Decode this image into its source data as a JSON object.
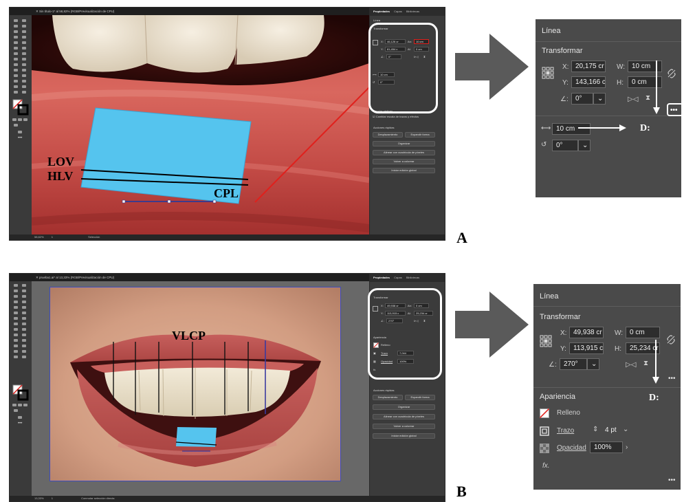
{
  "figure_a": {
    "letter": "A",
    "window": {
      "title": "Sin título-1* al 58,82% (RGB/Previsualización de CPU)",
      "zoom": "58,82%",
      "page": "1",
      "status_tool": "Selección"
    },
    "overlay_labels": {
      "lov": "LOV",
      "hlv": "HLV",
      "cpl": "CPL"
    },
    "panel": {
      "tabs": [
        "Propiedades",
        "Capas",
        "Bibliotecas"
      ],
      "section_header": "Línea",
      "transform": "Transformar",
      "x_value": "46,126 cr",
      "y_value": "81,454 c",
      "w_label": "An:",
      "w_value": "10 cm",
      "h_label": "Al:",
      "h_value": "0 cm",
      "angle_value": "0°",
      "length_value": "10 cm",
      "rotation_value": "0°",
      "scale_corners": "Escalar vértices",
      "scale_strokes": "Cambiar escala de trazos y efectos",
      "quick_actions": "Acciones rápidas",
      "btn_offset": "Desplazamiento",
      "btn_expand": "Expandir forma",
      "btn_arrange": "Organizar",
      "btn_align_grid": "Alinear con cuadrícula de píxeles",
      "btn_recolor": "Volver a colorear",
      "btn_global_edit": "Iniciar edición global"
    },
    "zoom_panel": {
      "title": "Línea",
      "transform": "Transformar",
      "x_label": "X:",
      "x_value": "20,175 cr",
      "y_label": "Y:",
      "y_value": "143,166 c",
      "w_label": "W:",
      "w_value": "10 cm",
      "h_label": "H:",
      "h_value": "0 cm",
      "angle_value": "0°",
      "length_value": "10 cm",
      "rotation_value": "0°",
      "d_label": "D:"
    }
  },
  "figure_b": {
    "letter": "B",
    "window": {
      "title": "prueba1.ai* al 13,33% (RGB/Previsualización de CPU)",
      "zoom": "13,33%",
      "page": "1",
      "status_tool": "Conmutar selección directa"
    },
    "overlay_labels": {
      "vlcp": "VLCP"
    },
    "panel": {
      "tabs": [
        "Propiedades",
        "Capas",
        "Bibliotecas"
      ],
      "transform": "Transformar",
      "x_value": "49,938 cr",
      "y_value": "113,915 c",
      "w_label": "An:",
      "w_value": "0 cm",
      "h_label": "Al:",
      "h_value": "25,234 cr",
      "angle_value": "270°",
      "appearance": "Apariencia",
      "fill": "Relleno",
      "stroke": "Trazo",
      "stroke_value": "7,044",
      "opacity": "Opacidad",
      "opacity_value": "100%",
      "fx": "fx.",
      "quick_actions": "Acciones rápidas",
      "btn_offset": "Desplazamiento",
      "btn_expand": "Expandir forma",
      "btn_arrange": "Organizar",
      "btn_align_grid": "Alinear con cuadrícula de píxeles",
      "btn_recolor": "Volver a colorear",
      "btn_global_edit": "Iniciar edición global"
    },
    "zoom_panel": {
      "title": "Línea",
      "transform": "Transformar",
      "x_label": "X:",
      "x_value": "49,938 cr",
      "y_label": "Y:",
      "y_value": "113,915 c",
      "w_label": "W:",
      "w_value": "0 cm",
      "h_label": "H:",
      "h_value": "25,234 cr",
      "angle_value": "270°",
      "appearance": "Apariencia",
      "fill": "Relleno",
      "stroke": "Trazo",
      "stroke_value": "4 pt",
      "opacity": "Opacidad",
      "opacity_value": "100%",
      "fx": "fx.",
      "d_label": "D:"
    }
  },
  "colors": {
    "ui_dark": "#323232",
    "ui_panel": "#4a4a4a",
    "arrow_gray": "#5a5a5a",
    "callout": "#ffffff",
    "highlight_red": "#e0201c",
    "tape_blue": "#55c4ee"
  }
}
